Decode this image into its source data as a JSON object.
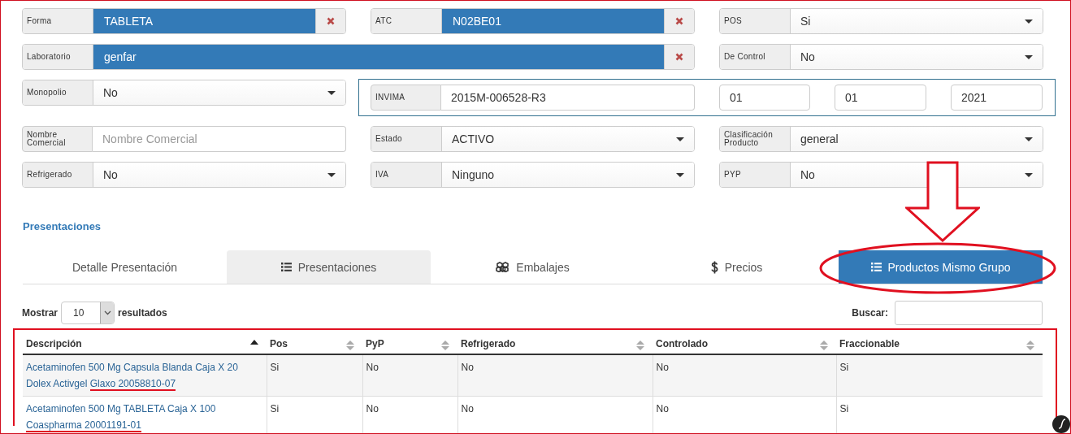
{
  "page": {
    "framed": true
  },
  "form": {
    "rows": [
      [
        {
          "kind": "tag",
          "label": "Forma",
          "value": "TABLETA",
          "wide": false
        },
        {
          "kind": "tag",
          "label": "ATC",
          "value": "N02BE01",
          "wide": false
        },
        {
          "kind": "select",
          "label": "POS",
          "value": "Si"
        }
      ],
      [
        {
          "kind": "tag",
          "label": "Laboratorio",
          "value": "genfar",
          "wide": true
        },
        {
          "kind": "select",
          "label": "De Control",
          "value": "No"
        }
      ],
      [
        {
          "kind": "select",
          "label": "Monopolio",
          "value": "No"
        },
        {
          "kind": "registration",
          "label": "INVIMA",
          "value": "2015M-006528-R3",
          "dates": [
            "01",
            "01",
            "2021"
          ]
        }
      ],
      [
        {
          "kind": "text",
          "label": "Nombre Comercial",
          "placeholder": "Nombre Comercial"
        },
        {
          "kind": "select",
          "label": "Estado",
          "value": "ACTIVO"
        },
        {
          "kind": "select",
          "label": "Clasificación Producto",
          "value": "general"
        }
      ],
      [
        {
          "kind": "select",
          "label": "Refrigerado",
          "value": "No"
        },
        {
          "kind": "select",
          "label": "IVA",
          "value": "Ninguno"
        },
        {
          "kind": "select",
          "label": "PYP",
          "value": "No"
        }
      ]
    ]
  },
  "section_title": "Presentaciones",
  "tabs": [
    {
      "label": "Detalle Presentación",
      "selected": false,
      "hovered": false,
      "circled": false
    },
    {
      "label": "Presentaciones",
      "selected": false,
      "hovered": true,
      "circled": false
    },
    {
      "label": "Embalajes",
      "selected": false,
      "hovered": false,
      "circled": false
    },
    {
      "label": "Precios",
      "selected": false,
      "hovered": false,
      "circled": false
    },
    {
      "label": "Productos Mismo Grupo",
      "selected": true,
      "hovered": false,
      "circled": true
    }
  ],
  "length_control": {
    "before": "Mostrar",
    "value": "10",
    "after": "resultados"
  },
  "search": {
    "label": "Buscar:"
  },
  "table": {
    "outlined": true,
    "columns": [
      {
        "label": "Descripción",
        "sorted": true
      },
      {
        "label": "Pos",
        "sorted": false
      },
      {
        "label": "PyP",
        "sorted": false
      },
      {
        "label": "Refrigerado",
        "sorted": false
      },
      {
        "label": "Controlado",
        "sorted": false
      },
      {
        "label": "Fraccionable",
        "sorted": false
      }
    ],
    "rows": [
      {
        "cells": [
          "Acetaminofen 500 Mg Capsula Blanda Caja X 20 Dolex Activgel",
          "Si",
          "No",
          "No",
          "No",
          "Si"
        ],
        "marked": "Glaxo 20058810-07"
      },
      {
        "cells": [
          "Acetaminofen 500 Mg TABLETA Caja X 100",
          "Si",
          "No",
          "No",
          "No",
          "Si"
        ],
        "marked": "Coaspharma 20001191-01"
      }
    ]
  }
}
